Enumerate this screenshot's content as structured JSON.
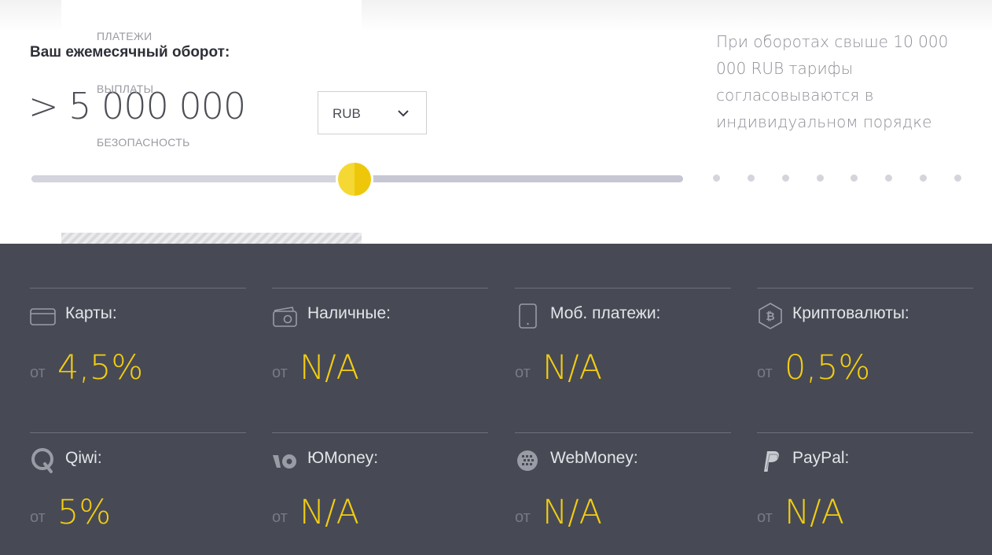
{
  "menu": {
    "items": [
      "ПЛАТЕЖИ",
      "ВЫПЛАТЫ",
      "БЕЗОПАСНОСТЬ"
    ]
  },
  "calculator": {
    "heading": "Ваш ежемесячный оборот:",
    "amount": "> 5 000 000",
    "currency": "RUB",
    "note": "При оборотах свыше 10 000 000 RUB тарифы согласовываются в индивидуальном порядке",
    "slider_fraction": 0.5
  },
  "prefix": "от",
  "rates": [
    {
      "label": "Карты:",
      "rate": "4,5%",
      "icon": "card-icon"
    },
    {
      "label": "Наличные:",
      "rate": "N/A",
      "icon": "cash-icon"
    },
    {
      "label": "Моб. платежи:",
      "rate": "N/A",
      "icon": "mobile-icon"
    },
    {
      "label": "Криптовалюты:",
      "rate": "0,5%",
      "icon": "bitcoin-icon"
    },
    {
      "label": "Qiwi:",
      "rate": "5%",
      "icon": "qiwi-icon"
    },
    {
      "label": "ЮMoney:",
      "rate": "N/A",
      "icon": "yoomoney-icon"
    },
    {
      "label": "WebMoney:",
      "rate": "N/A",
      "icon": "webmoney-icon"
    },
    {
      "label": "PayPal:",
      "rate": "N/A",
      "icon": "paypal-icon"
    }
  ],
  "colors": {
    "accent": "#f3cd12",
    "dark_bg": "#474a54"
  }
}
